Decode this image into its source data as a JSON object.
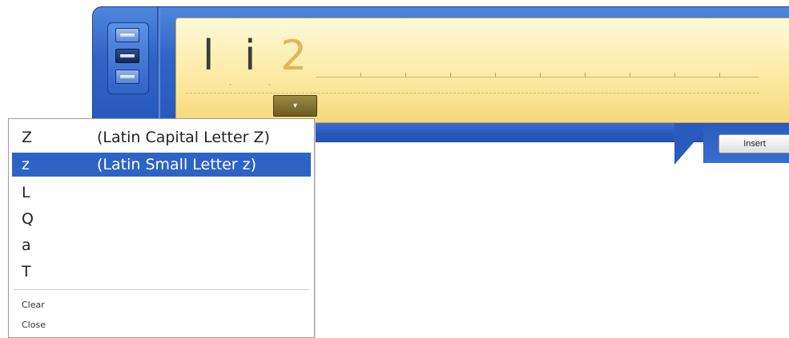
{
  "writing_pad": {
    "recognized_chars": [
      "l",
      "i",
      "2"
    ],
    "separator": "."
  },
  "mode_buttons": [
    {
      "name": "mode-writing-pad",
      "selected": false
    },
    {
      "name": "mode-character-pad",
      "selected": true
    },
    {
      "name": "mode-keyboard",
      "selected": false
    }
  ],
  "insert_label": "Insert",
  "dropdown_arrow": "▾",
  "alternates_menu": {
    "items": [
      {
        "char": "Z",
        "name": "(Latin Capital Letter Z)",
        "selected": false
      },
      {
        "char": "z",
        "name": "(Latin Small Letter z)",
        "selected": true
      },
      {
        "char": "L",
        "name": "",
        "selected": false
      },
      {
        "char": "Q",
        "name": "",
        "selected": false
      },
      {
        "char": "a",
        "name": "",
        "selected": false
      },
      {
        "char": "T",
        "name": "",
        "selected": false
      }
    ],
    "commands": {
      "clear": "Clear",
      "close": "Close"
    }
  },
  "colors": {
    "frame_blue": "#2e62c4",
    "pad_yellow": "#fdeaa4",
    "selection": "#2e63c6"
  }
}
